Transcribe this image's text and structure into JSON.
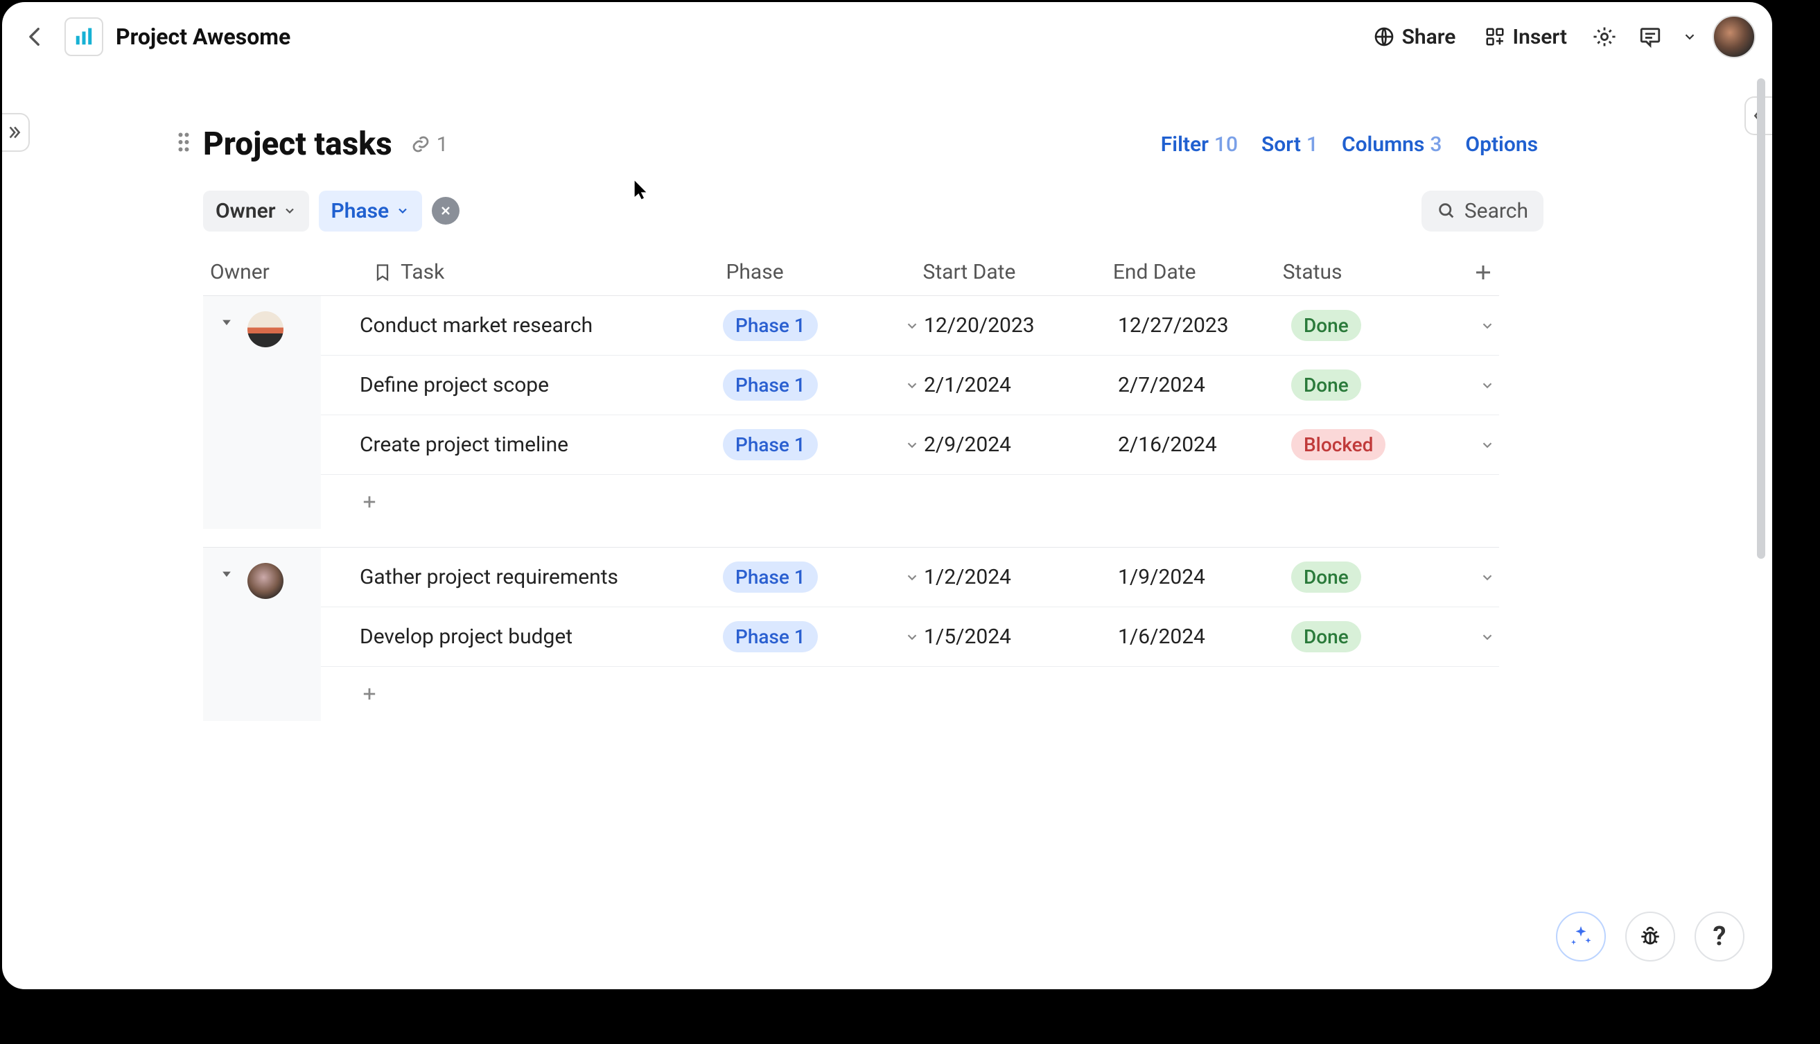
{
  "app": {
    "title": "Project Awesome"
  },
  "topbar": {
    "share": "Share",
    "insert": "Insert"
  },
  "view": {
    "title": "Project tasks",
    "link_count": "1",
    "filter_label": "Filter",
    "filter_count": "10",
    "sort_label": "Sort",
    "sort_count": "1",
    "columns_label": "Columns",
    "columns_count": "3",
    "options_label": "Options"
  },
  "chips": {
    "owner": "Owner",
    "phase": "Phase",
    "search": "Search"
  },
  "columns": {
    "owner": "Owner",
    "task": "Task",
    "phase": "Phase",
    "start": "Start Date",
    "end": "End Date",
    "status": "Status"
  },
  "status_labels": {
    "done": "Done",
    "blocked": "Blocked"
  },
  "phase_labels": {
    "p1": "Phase 1"
  },
  "groups": [
    {
      "owner_style": "a",
      "rows": [
        {
          "task": "Conduct market research",
          "phase": "p1",
          "start": "12/20/2023",
          "end": "12/27/2023",
          "status": "done"
        },
        {
          "task": "Define project scope",
          "phase": "p1",
          "start": "2/1/2024",
          "end": "2/7/2024",
          "status": "done"
        },
        {
          "task": "Create project timeline",
          "phase": "p1",
          "start": "2/9/2024",
          "end": "2/16/2024",
          "status": "blocked"
        }
      ]
    },
    {
      "owner_style": "b",
      "rows": [
        {
          "task": "Gather project requirements",
          "phase": "p1",
          "start": "1/2/2024",
          "end": "1/9/2024",
          "status": "done"
        },
        {
          "task": "Develop project budget",
          "phase": "p1",
          "start": "1/5/2024",
          "end": "1/6/2024",
          "status": "done"
        }
      ]
    }
  ]
}
